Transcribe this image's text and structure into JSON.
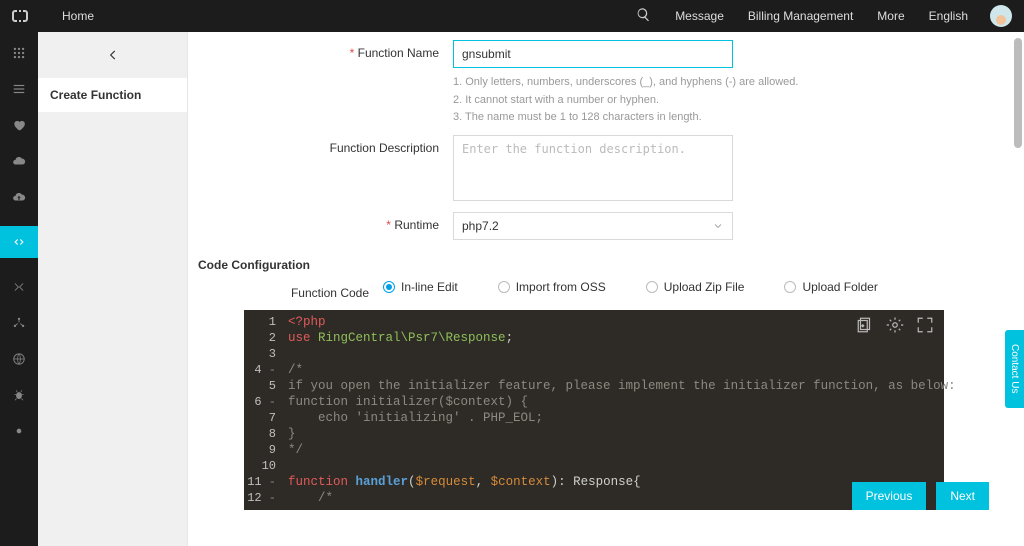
{
  "topbar": {
    "home": "Home",
    "message": "Message",
    "billing": "Billing Management",
    "more": "More",
    "english": "English"
  },
  "sidebar": {
    "title": "Create Function"
  },
  "form": {
    "fn_name_label": "Function Name",
    "fn_name_value": "gnsubmit",
    "fn_name_hint1": "1. Only letters, numbers, underscores (_), and hyphens (-) are allowed.",
    "fn_name_hint2": "2. It cannot start with a number or hyphen.",
    "fn_name_hint3": "3. The name must be 1 to 128 characters in length.",
    "fn_desc_label": "Function Description",
    "fn_desc_placeholder": "Enter the function description.",
    "runtime_label": "Runtime",
    "runtime_value": "php7.2"
  },
  "codecfg": {
    "section": "Code Configuration",
    "label": "Function Code",
    "opts": {
      "inline": "In-line Edit",
      "oss": "Import from OSS",
      "zip": "Upload Zip File",
      "folder": "Upload Folder"
    }
  },
  "footer": {
    "prev": "Previous",
    "next": "Next"
  },
  "contact": "Contact Us",
  "chart_data": null
}
